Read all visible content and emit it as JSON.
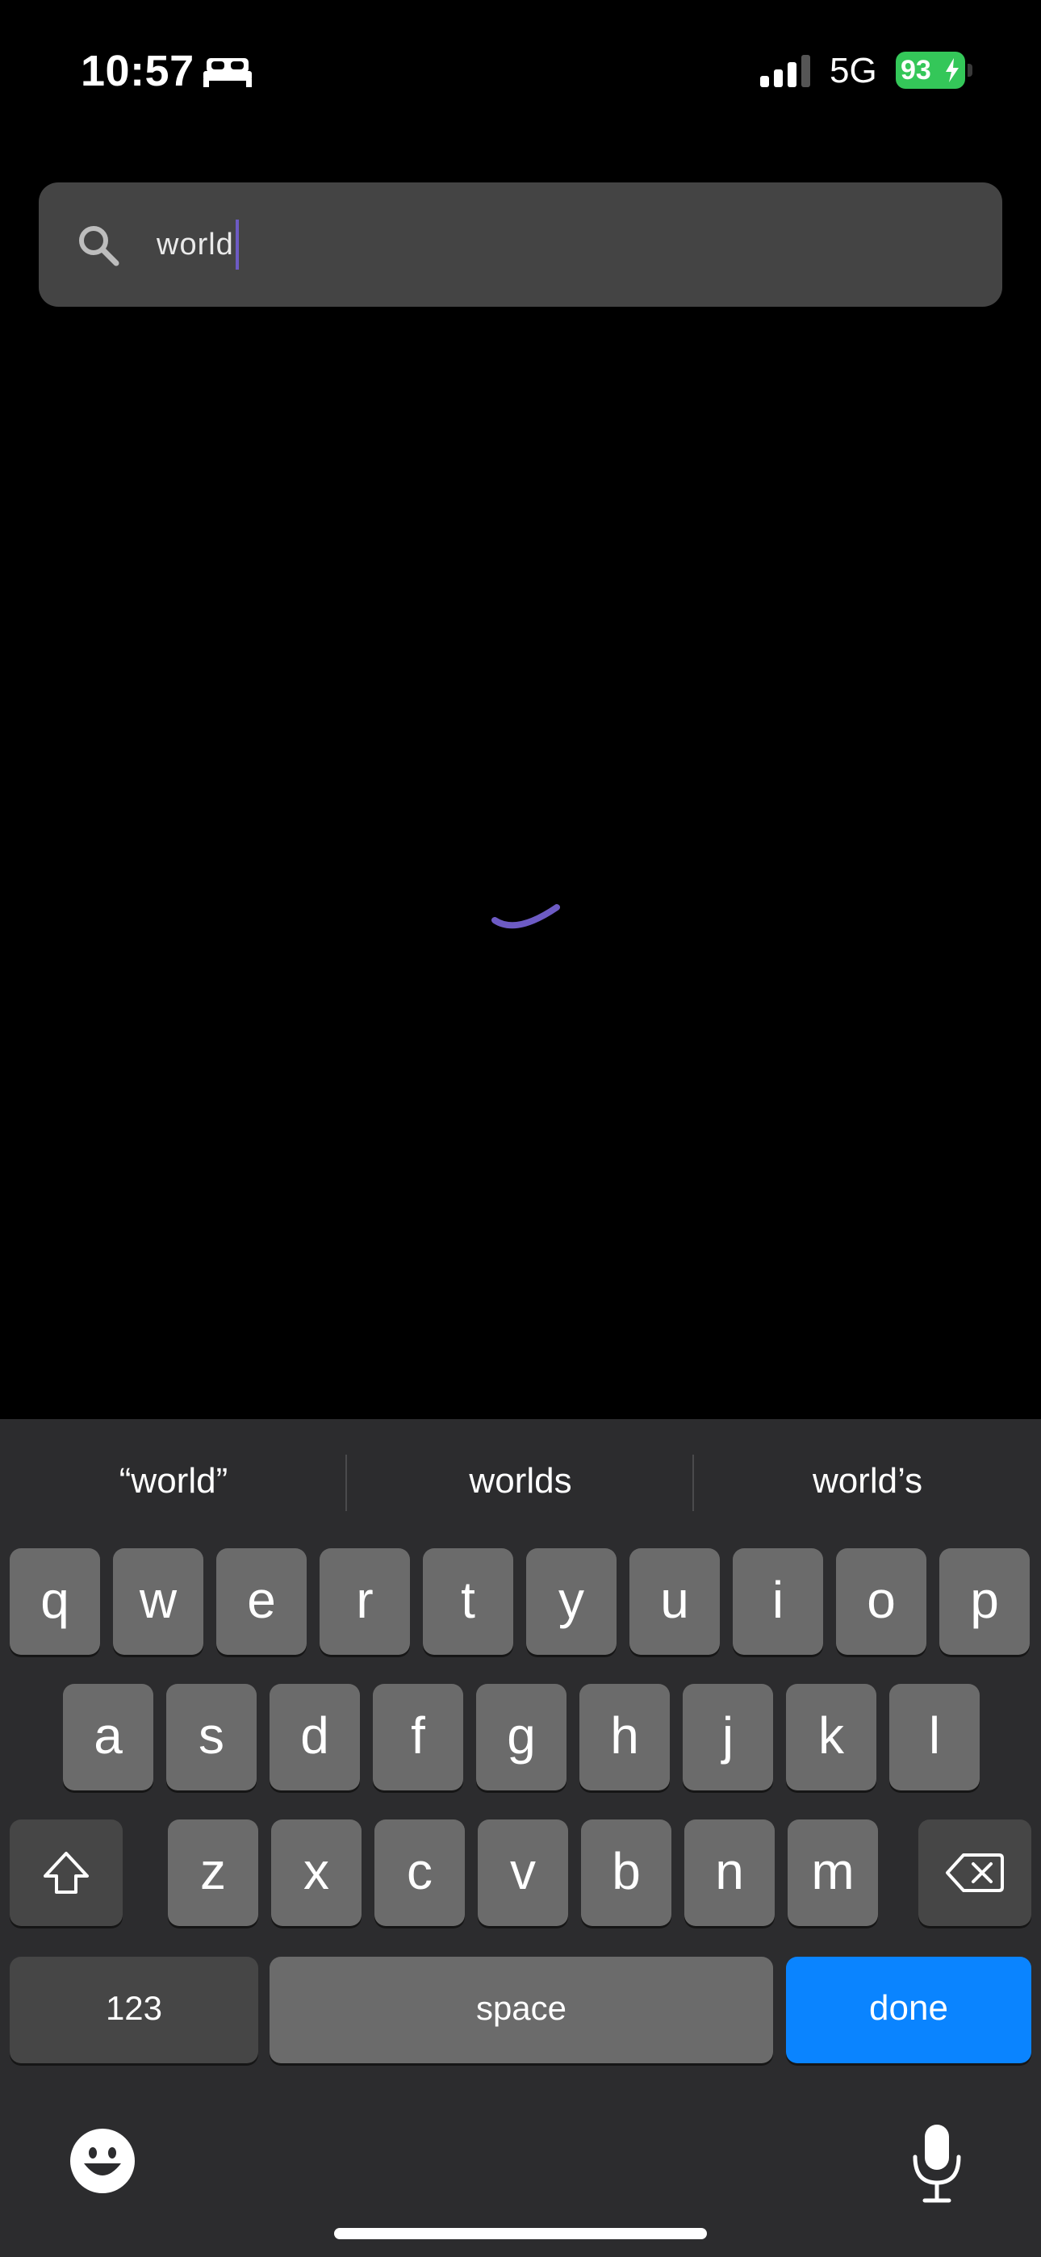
{
  "status_bar": {
    "time": "10:57",
    "network": "5G",
    "battery_percent": "93",
    "icons": [
      "bed-icon",
      "signal-icon",
      "battery-icon",
      "charging-bolt-icon"
    ]
  },
  "search": {
    "value": "world",
    "icon": "search-icon"
  },
  "loading": {
    "state": "spinner",
    "color": "#6d5bc4"
  },
  "keyboard": {
    "suggestions": [
      "“world”",
      "worlds",
      "world’s"
    ],
    "row1": [
      "q",
      "w",
      "e",
      "r",
      "t",
      "y",
      "u",
      "i",
      "o",
      "p"
    ],
    "row2": [
      "a",
      "s",
      "d",
      "f",
      "g",
      "h",
      "j",
      "k",
      "l"
    ],
    "row3": [
      "z",
      "x",
      "c",
      "v",
      "b",
      "n",
      "m"
    ],
    "numbers_label": "123",
    "space_label": "space",
    "done_label": "done",
    "done_color": "#0a84ff",
    "icons": [
      "shift-icon",
      "backspace-icon",
      "emoji-icon",
      "microphone-icon"
    ]
  }
}
